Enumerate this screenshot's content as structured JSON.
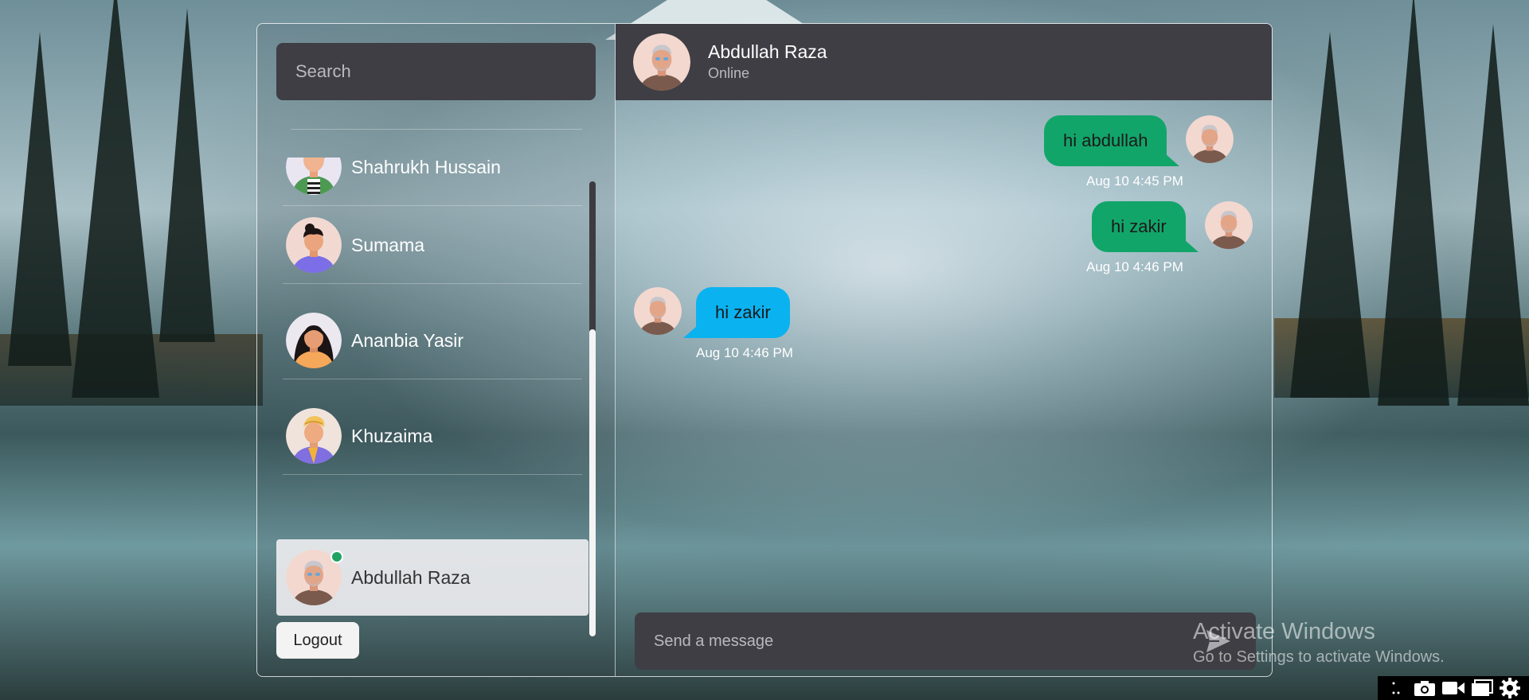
{
  "search": {
    "placeholder": "Search"
  },
  "contacts": [
    {
      "name": "Shahrukh Hussain",
      "avatar": "avatar-male-green-shirt",
      "active": false,
      "online": false
    },
    {
      "name": "Sumama",
      "avatar": "avatar-male-purple-shirt",
      "active": false,
      "online": false
    },
    {
      "name": "Ananbia Yasir",
      "avatar": "avatar-female-orange-shirt",
      "active": false,
      "online": false
    },
    {
      "name": "Khuzaima",
      "avatar": "avatar-male-turban-purple",
      "active": false,
      "online": false
    },
    {
      "name": "Abdullah Raza",
      "avatar": "avatar-elderly-male",
      "active": true,
      "online": true
    }
  ],
  "sidebar": {
    "logout_label": "Logout"
  },
  "chat": {
    "header": {
      "name": "Abdullah Raza",
      "status": "Online"
    },
    "messages": [
      {
        "text": "hi abdullah",
        "time": "Aug 10 4:45 PM",
        "direction": "outgoing"
      },
      {
        "text": "hi zakir",
        "time": "Aug 10 4:46 PM",
        "direction": "outgoing"
      },
      {
        "text": "hi zakir",
        "time": "Aug 10 4:46 PM",
        "direction": "incoming"
      }
    ],
    "composer": {
      "placeholder": "Send a message",
      "send_icon": "send-arrow-icon"
    }
  },
  "watermark": {
    "title": "Activate Windows",
    "subtitle": "Go to Settings to activate Windows."
  },
  "tray": {
    "icons": [
      "dots-icon",
      "camera-icon",
      "video-icon",
      "window-icon",
      "gear-icon"
    ]
  },
  "colors": {
    "panel": "#3e3e44",
    "outgoing_bubble": "#12a56a",
    "incoming_bubble": "#0bb2f0",
    "online": "#1fa463"
  }
}
